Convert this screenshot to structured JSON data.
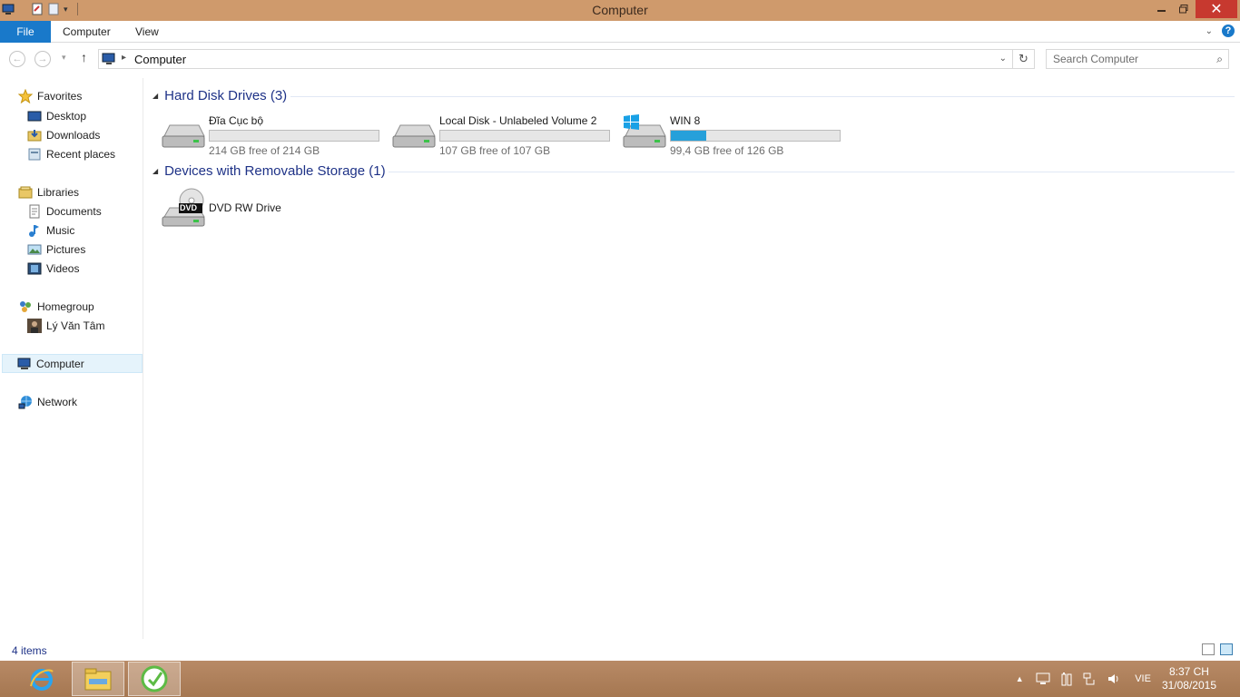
{
  "window": {
    "title": "Computer"
  },
  "ribbon": {
    "tabs": [
      {
        "label": "File"
      },
      {
        "label": "Computer"
      },
      {
        "label": "View"
      }
    ]
  },
  "address": {
    "path": "Computer"
  },
  "search": {
    "placeholder": "Search Computer"
  },
  "navpane": {
    "favorites": {
      "label": "Favorites",
      "items": [
        {
          "label": "Desktop"
        },
        {
          "label": "Downloads"
        },
        {
          "label": "Recent places"
        }
      ]
    },
    "libraries": {
      "label": "Libraries",
      "items": [
        {
          "label": "Documents"
        },
        {
          "label": "Music"
        },
        {
          "label": "Pictures"
        },
        {
          "label": "Videos"
        }
      ]
    },
    "homegroup": {
      "label": "Homegroup",
      "items": [
        {
          "label": "Lý Văn Tâm"
        }
      ]
    },
    "computer": {
      "label": "Computer"
    },
    "network": {
      "label": "Network"
    }
  },
  "content": {
    "groups": [
      {
        "title": "Hard Disk Drives (3)",
        "drives": [
          {
            "name": "Đĩa Cục bộ",
            "free": "214 GB free of 214 GB",
            "used_fraction": 0.0,
            "icon": "hard-drive-icon"
          },
          {
            "name": "Local Disk - Unlabeled Volume 2",
            "free": "107 GB free of 107 GB",
            "used_fraction": 0.0,
            "icon": "hard-drive-icon"
          },
          {
            "name": "WIN 8",
            "free": "99,4 GB free of 126 GB",
            "used_fraction": 0.21,
            "icon": "windows-drive-icon"
          }
        ]
      },
      {
        "title": "Devices with Removable Storage (1)",
        "devices": [
          {
            "name": "DVD RW Drive",
            "icon": "dvd-drive-icon",
            "badge": "DVD"
          }
        ]
      }
    ]
  },
  "status": {
    "count": "4 items"
  },
  "taskbar": {
    "lang": "VIE",
    "time": "8:37 CH",
    "date": "31/08/2015"
  },
  "colors": {
    "accent": "#1979ca",
    "bar_fill": "#26a0da",
    "group_title": "#1e3287",
    "close": "#c7392f"
  }
}
